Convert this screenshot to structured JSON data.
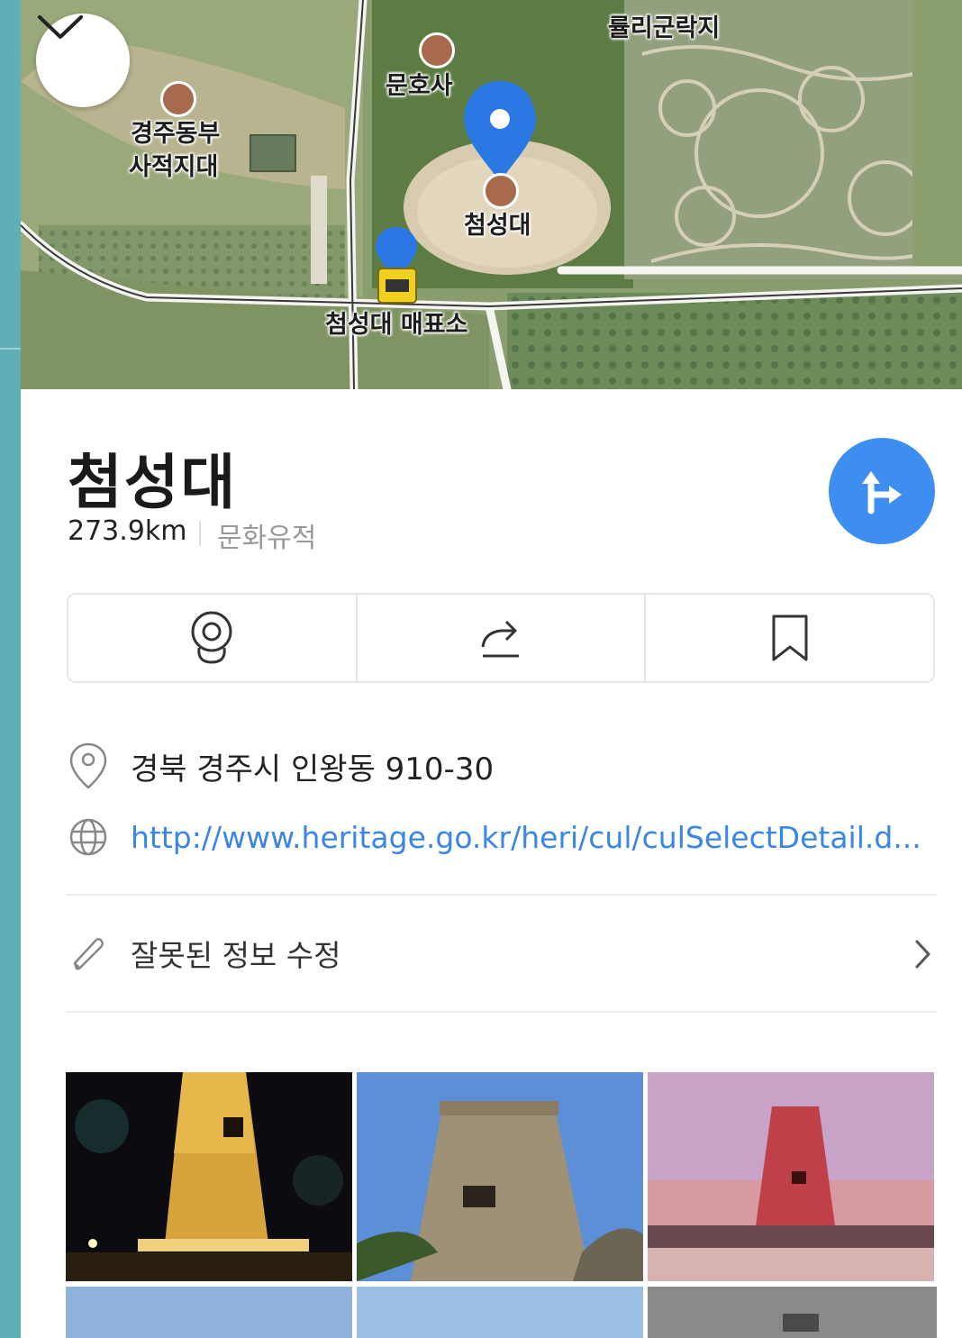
{
  "map": {
    "labels": {
      "yulligun": "률리군락지",
      "munhosa": "문호사",
      "dongbu_line1": "경주동부",
      "dongbu_line2": "사적지대",
      "cheomseongdae": "첨성대",
      "ticket_office": "첨성대 매표소"
    }
  },
  "place": {
    "name": "첨성대",
    "distance": "273.9km",
    "category": "문화유적",
    "address": "경북 경주시 인왕동 910-30",
    "url": "http://www.heritage.go.kr/heri/cul/culSelectDetail.d...",
    "edit_label": "잘못된 정보 수정"
  },
  "actions": {
    "items": [
      "roadview-icon",
      "share-icon",
      "bookmark-icon"
    ]
  },
  "colors": {
    "accent": "#3d8ef0",
    "link": "#3a86e8",
    "side_strip": "#5fb0b6"
  }
}
